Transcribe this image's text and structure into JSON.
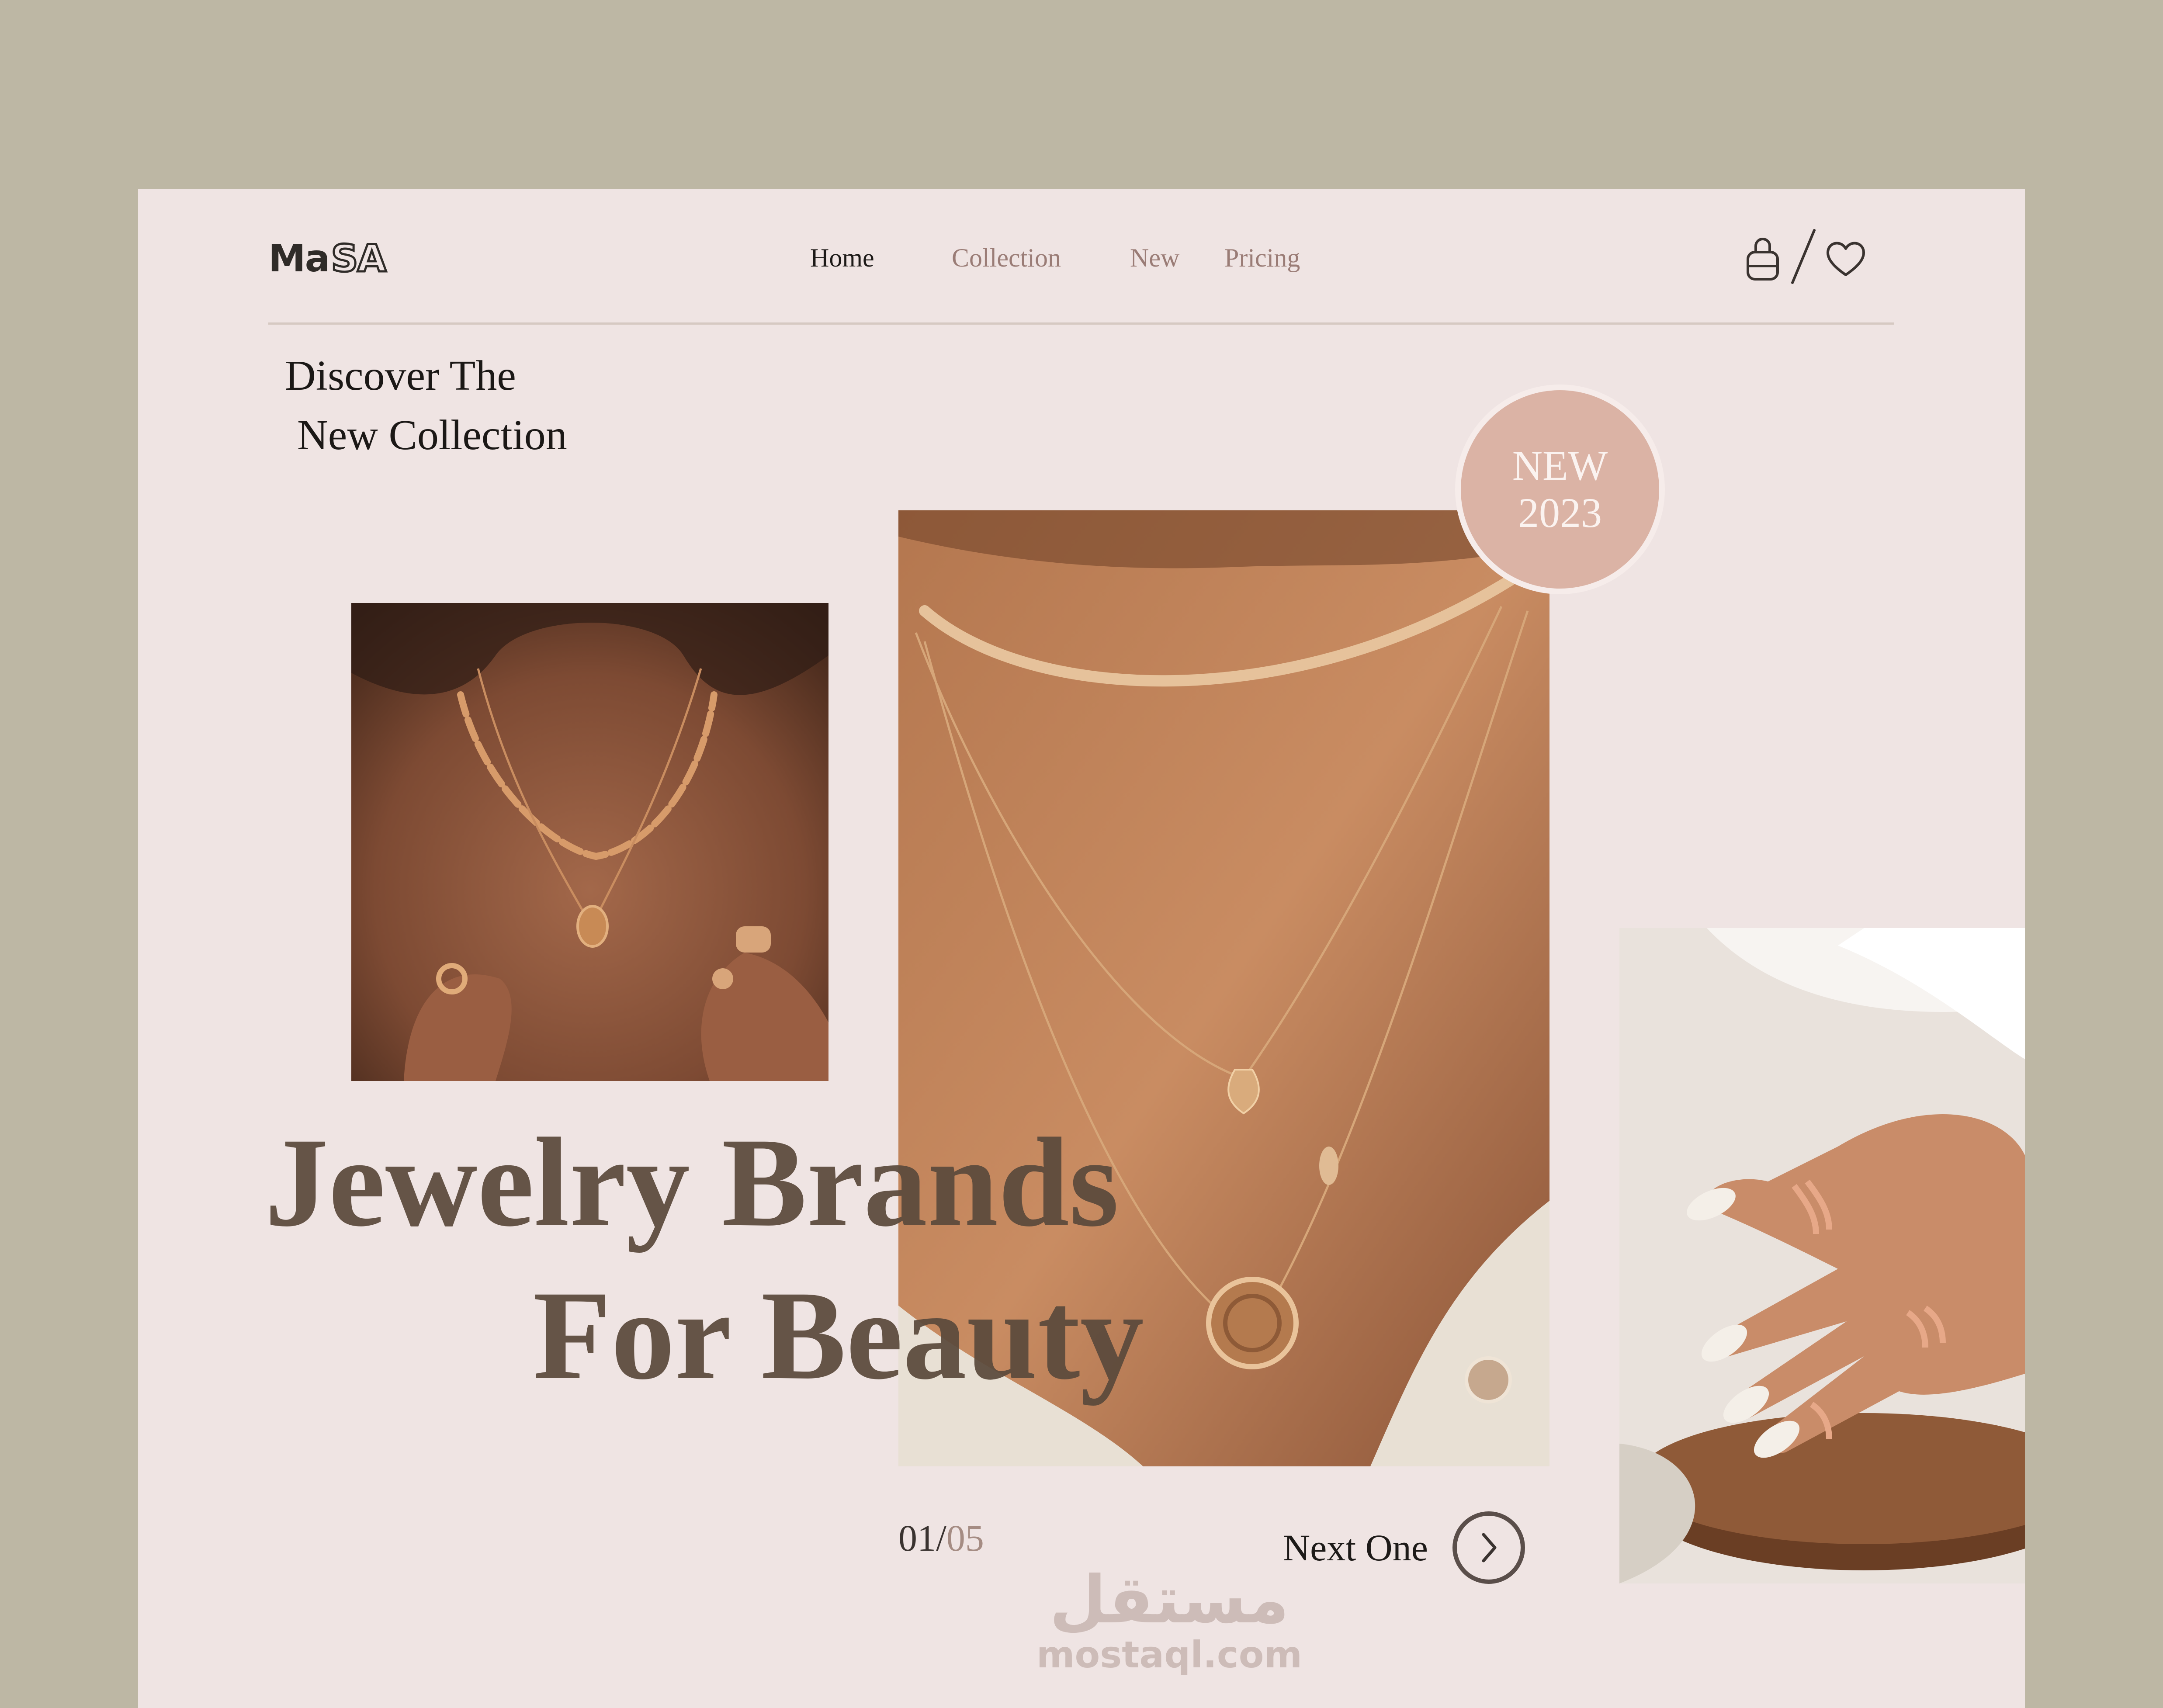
{
  "brand": {
    "logo_solid": "Ma",
    "logo_outline": "SA"
  },
  "nav": {
    "items": [
      {
        "label": "Home"
      },
      {
        "label": "Collection"
      },
      {
        "label": "New"
      },
      {
        "label": "Pricing"
      }
    ],
    "active": "Home"
  },
  "header_icons": [
    "shopping-bag-icon",
    "heart-icon"
  ],
  "hero": {
    "eyebrow_line1": "Discover The",
    "eyebrow_line2": "New Collection",
    "badge_line1": "NEW",
    "badge_line2": "2023",
    "headline_line1": "Jewelry Brands",
    "headline_line2": "For Beauty"
  },
  "slider": {
    "current": "01",
    "separator": "/",
    "total": "05",
    "next_label": "Next One"
  },
  "watermark": {
    "arabic": "مستقل",
    "latin": "mostaql.com"
  },
  "colors": {
    "outer_background": "#bdb7a4",
    "page_background": "#efe4e3",
    "headline": "#5b4a3c",
    "badge": "#dbb3a5",
    "nav_inactive": "#9a7c76"
  }
}
